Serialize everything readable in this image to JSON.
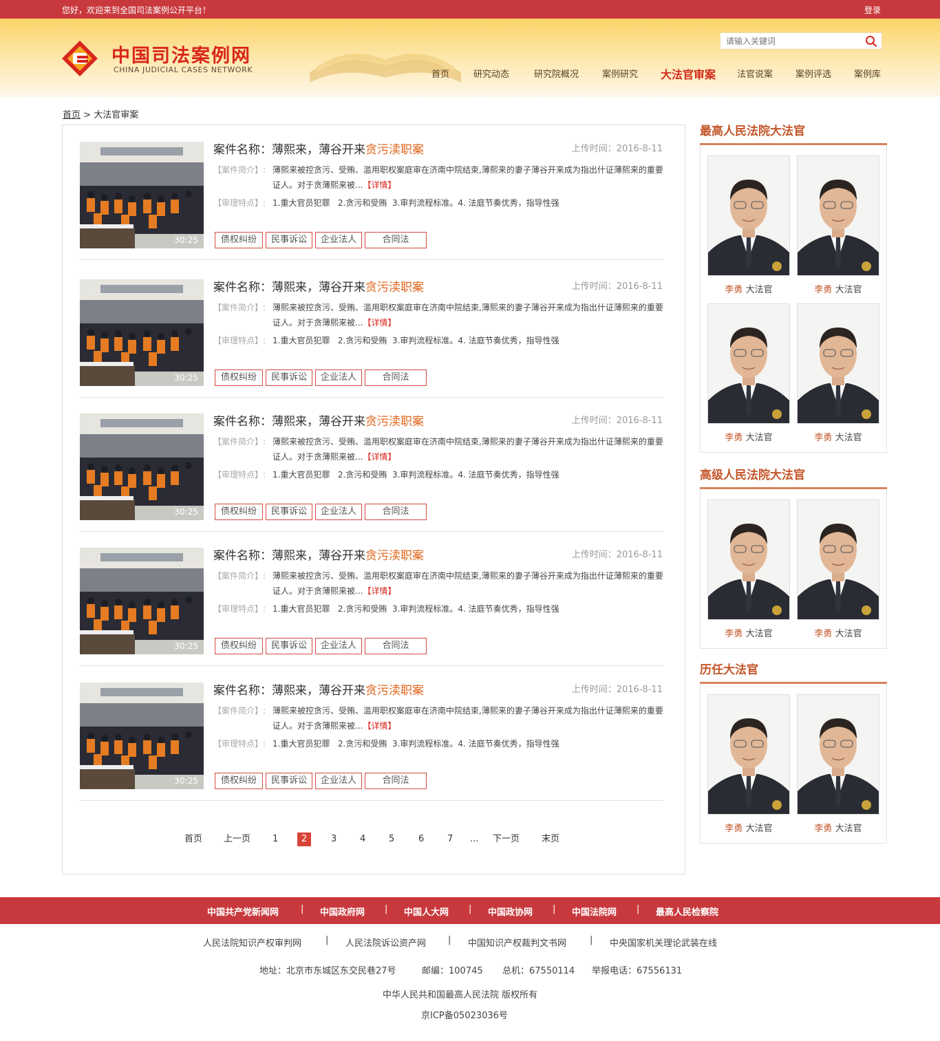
{
  "topbar": {
    "welcome": "您好，欢迎来到全国司法案例公开平台！",
    "login": "登录"
  },
  "logo": {
    "cn": "中国司法案例网",
    "en": "CHINA JUDICIAL CASES NETWORK"
  },
  "search": {
    "placeholder": "请输入关键词"
  },
  "nav": [
    "首页",
    "研究动态",
    "研究院概况",
    "案例研究",
    "大法官审案",
    "法官说案",
    "案例评选",
    "案例库"
  ],
  "nav_active": "大法官审案",
  "breadcrumb": {
    "home": "首页",
    "sep": ">",
    "current": "大法官审案"
  },
  "cases": [
    {
      "title": "案件名称：薄熙来，薄谷开来",
      "title_hl": "贪污渎职案",
      "time": "上传时间：2016-8-11",
      "intro_label": "【案件简介】:",
      "intro": "薄熙来被控贪污、受贿、滥用职权案庭审在济南中院结束,薄熙来的妻子薄谷开来成为指出什证薄熙来的重要证人。对于贪薄熙来被...",
      "more": "【详情】",
      "feat_label": "【审理特点】:",
      "features": "1.重大官员犯罪   2.贪污和受贿  3.审判流程标准。4. 法庭节奏优秀，指导性强",
      "duration": "30:25",
      "tags": [
        "债权纠纷",
        "民事诉讼",
        "企业法人",
        "合同法"
      ]
    },
    {
      "title": "案件名称：薄熙来，薄谷开来",
      "title_hl": "贪污渎职案",
      "time": "上传时间：2016-8-11",
      "intro_label": "【案件简介】:",
      "intro": "薄熙来被控贪污、受贿、滥用职权案庭审在济南中院结束,薄熙来的妻子薄谷开来成为指出什证薄熙来的重要证人。对于贪薄熙来被...",
      "more": "【详情】",
      "feat_label": "【审理特点】:",
      "features": "1.重大官员犯罪   2.贪污和受贿  3.审判流程标准。4. 法庭节奏优秀，指导性强",
      "duration": "30:25",
      "tags": [
        "债权纠纷",
        "民事诉讼",
        "企业法人",
        "合同法"
      ]
    },
    {
      "title": "案件名称：薄熙来，薄谷开来",
      "title_hl": "贪污渎职案",
      "time": "上传时间：2016-8-11",
      "intro_label": "【案件简介】:",
      "intro": "薄熙来被控贪污、受贿、滥用职权案庭审在济南中院结束,薄熙来的妻子薄谷开来成为指出什证薄熙来的重要证人。对于贪薄熙来被...",
      "more": "【详情】",
      "feat_label": "【审理特点】:",
      "features": "1.重大官员犯罪   2.贪污和受贿  3.审判流程标准。4. 法庭节奏优秀，指导性强",
      "duration": "30:25",
      "tags": [
        "债权纠纷",
        "民事诉讼",
        "企业法人",
        "合同法"
      ]
    },
    {
      "title": "案件名称：薄熙来，薄谷开来",
      "title_hl": "贪污渎职案",
      "time": "上传时间：2016-8-11",
      "intro_label": "【案件简介】:",
      "intro": "薄熙来被控贪污、受贿、滥用职权案庭审在济南中院结束,薄熙来的妻子薄谷开来成为指出什证薄熙来的重要证人。对于贪薄熙来被...",
      "more": "【详情】",
      "feat_label": "【审理特点】:",
      "features": "1.重大官员犯罪   2.贪污和受贿  3.审判流程标准。4. 法庭节奏优秀，指导性强",
      "duration": "30:25",
      "tags": [
        "债权纠纷",
        "民事诉讼",
        "企业法人",
        "合同法"
      ]
    },
    {
      "title": "案件名称：薄熙来，薄谷开来",
      "title_hl": "贪污渎职案",
      "time": "上传时间：2016-8-11",
      "intro_label": "【案件简介】:",
      "intro": "薄熙来被控贪污、受贿、滥用职权案庭审在济南中院结束,薄熙来的妻子薄谷开来成为指出什证薄熙来的重要证人。对于贪薄熙来被...",
      "more": "【详情】",
      "feat_label": "【审理特点】:",
      "features": "1.重大官员犯罪   2.贪污和受贿  3.审判流程标准。4. 法庭节奏优秀，指导性强",
      "duration": "30:25",
      "tags": [
        "债权纠纷",
        "民事诉讼",
        "企业法人",
        "合同法"
      ]
    }
  ],
  "pager": [
    "首页",
    "上一页",
    "1",
    "2",
    "3",
    "4",
    "5",
    "6",
    "7",
    "...",
    "下一页",
    "末页"
  ],
  "pager_current": "2",
  "sidebar": [
    {
      "title": "最高人民法院大法官",
      "judges": [
        {
          "name": "李勇",
          "role": "大法官"
        },
        {
          "name": "李勇",
          "role": "大法官"
        },
        {
          "name": "李勇",
          "role": "大法官"
        },
        {
          "name": "李勇",
          "role": "大法官"
        }
      ]
    },
    {
      "title": "高级人民法院大法官",
      "judges": [
        {
          "name": "李勇",
          "role": "大法官"
        },
        {
          "name": "李勇",
          "role": "大法官"
        }
      ]
    },
    {
      "title": "历任大法官",
      "judges": [
        {
          "name": "李勇",
          "role": "大法官"
        },
        {
          "name": "李勇",
          "role": "大法官"
        }
      ]
    }
  ],
  "footer": {
    "links_primary": [
      "中国共产党新闻网",
      "中国政府网",
      "中国人大网",
      "中国政协网",
      "中国法院网",
      "最高人民检察院"
    ],
    "links_secondary": [
      "人民法院知识产权审判网",
      "人民法院诉讼资产网",
      "中国知识产权裁判文书网",
      "中央国家机关理论武装在线"
    ],
    "separator": "|",
    "address": "地址：北京市东城区东交民巷27号",
    "postcode": "邮编：100745",
    "phone": "总机：67550114",
    "report": "举报电话：67556131",
    "copyright": "中华人民共和国最高人民法院 版权所有",
    "icp": "京ICP备05023036号"
  },
  "colors": {
    "brand_red": "#c8393d",
    "accent_orange": "#e0651b",
    "section_title": "#c4562a"
  }
}
